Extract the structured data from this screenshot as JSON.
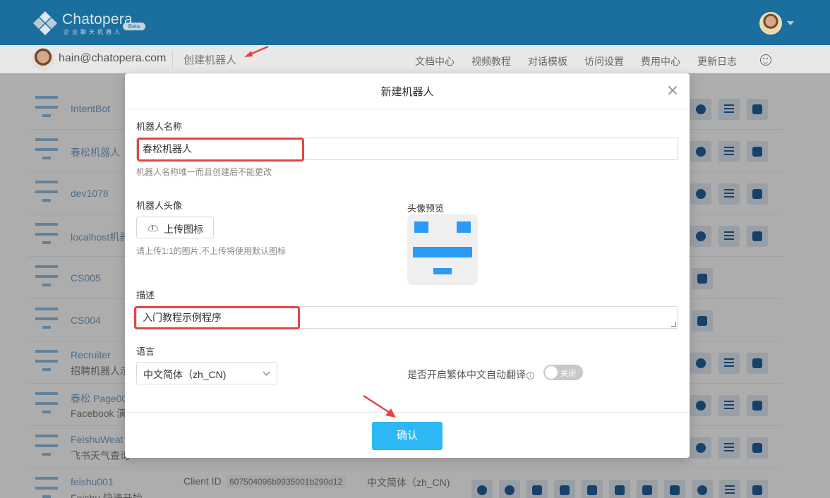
{
  "topbar": {
    "logo_text": "Chatopera",
    "logo_sub": "企业聊天机器人",
    "beta": "Beta",
    "brand_color": "#1b6f9e"
  },
  "subnav": {
    "email": "hain@chatopera.com",
    "create": "创建机器人",
    "links": [
      "文档中心",
      "视频教程",
      "对话模板",
      "访问设置",
      "费用中心",
      "更新日志"
    ]
  },
  "list": {
    "rows": [
      {
        "name": "IntentBot",
        "desc": ""
      },
      {
        "name": "春松机器人",
        "desc": ""
      },
      {
        "name": "dev1078",
        "desc": ""
      },
      {
        "name": "localhost机器",
        "desc": ""
      },
      {
        "name": "CS005",
        "desc": ""
      },
      {
        "name": "CS004",
        "desc": ""
      },
      {
        "name": "Recruiter",
        "desc": "招聘机器人示"
      },
      {
        "name": "春松 Page00",
        "desc": "Facebook 演"
      },
      {
        "name": "FeishuWeat",
        "desc": "飞书天气查询"
      },
      {
        "name": "feishu001",
        "desc": "Feishu 快速开始",
        "client_label": "Client ID",
        "client_id": "607504096b9935001b290d12",
        "lang": "中文简体（zh_CN)"
      }
    ]
  },
  "modal": {
    "title": "新建机器人",
    "name_label": "机器人名称",
    "name_value": "春松机器人",
    "name_hint": "机器人名称唯一而且创建后不能更改",
    "avatar_label": "机器人头像",
    "upload_label": "上传图标",
    "upload_hint": "请上传1:1的图片,不上传将使用默认图标",
    "preview_label": "头像预览",
    "desc_label": "描述",
    "desc_value": "入门教程示例程序",
    "lang_label": "语言",
    "lang_value": "中文简体（zh_CN)",
    "translate_label": "是否开启繁体中文自动翻译",
    "toggle_text": "关闭",
    "confirm": "确认",
    "accent_color": "#2cb7f5",
    "highlight_color": "#e54444"
  }
}
